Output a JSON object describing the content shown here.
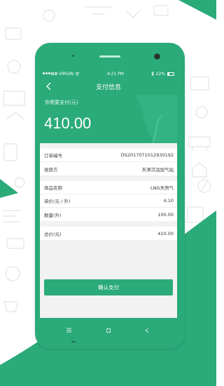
{
  "colors": {
    "brand_green": "#2baa7a",
    "doodle_line": "#dfe6e3",
    "page_bg": "#f2f2f2"
  },
  "status_bar": {
    "carrier": "VIRGIN",
    "time": "4:21 PM",
    "battery": "22%",
    "battery_level": 0.22
  },
  "nav": {
    "title": "支付信息",
    "back_icon": "chevron-left-icon"
  },
  "payment": {
    "label": "你需要支付(元)",
    "amount": "410.00"
  },
  "order": {
    "number_label": "订单编号",
    "number_value": "DS2017071012930192",
    "payee_label": "收款方",
    "payee_value": "天津汉沽加气站"
  },
  "goods": {
    "name_label": "商品名称",
    "name_value": "LNG天然气",
    "unit_price_label": "单价(元 / 升)",
    "unit_price_value": "4.10",
    "quantity_label": "数量(升)",
    "quantity_value": "100.00"
  },
  "total": {
    "label": "总价(元)",
    "value": "410.00"
  },
  "actions": {
    "confirm_label": "确认支付"
  },
  "device_nav": {
    "menu_icon": "menu-icon",
    "home_icon": "home-square-icon",
    "back_icon": "back-triangle-icon"
  }
}
